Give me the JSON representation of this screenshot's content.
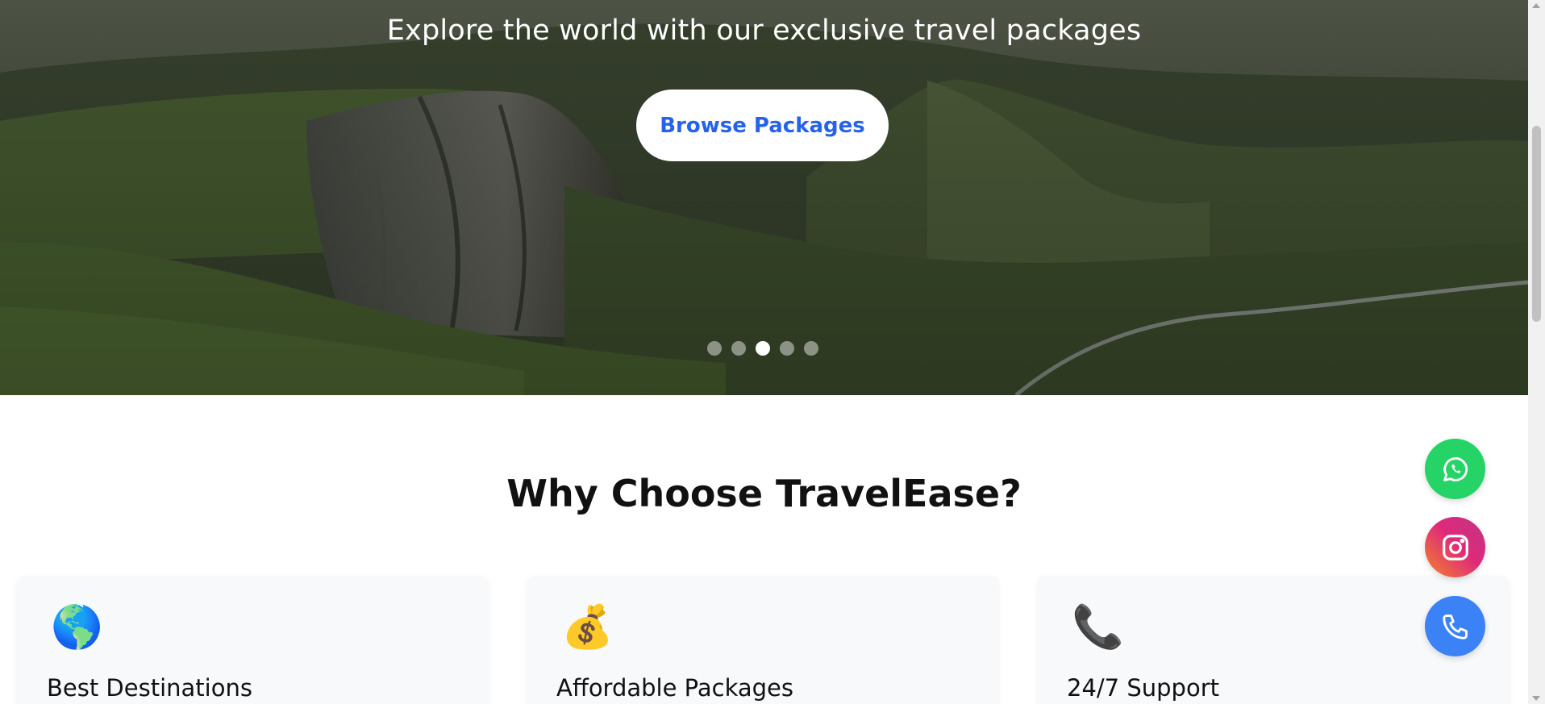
{
  "hero": {
    "subtitle": "Explore the world with our exclusive travel packages",
    "browse_button_label": "Browse Packages",
    "slides": [
      {
        "active": false
      },
      {
        "active": false
      },
      {
        "active": true
      },
      {
        "active": false
      },
      {
        "active": false
      }
    ]
  },
  "features": {
    "title": "Why Choose TravelEase?",
    "cards": [
      {
        "icon": "🌎",
        "icon_name": "globe-icon",
        "title": "Best Destinations"
      },
      {
        "icon": "💰",
        "icon_name": "money-bag-icon",
        "title": "Affordable Packages"
      },
      {
        "icon": "📞",
        "icon_name": "telephone-receiver-icon",
        "title": "24/7 Support"
      }
    ]
  },
  "floating": {
    "whatsapp": {
      "icon": "whatsapp-icon",
      "color": "#25d366"
    },
    "instagram": {
      "icon": "instagram-icon",
      "color": "#dd2a7b"
    },
    "phone": {
      "icon": "phone-icon",
      "color": "#3b82f6"
    }
  },
  "colors": {
    "accent": "#2563eb",
    "card_bg": "#f8f9fa"
  }
}
